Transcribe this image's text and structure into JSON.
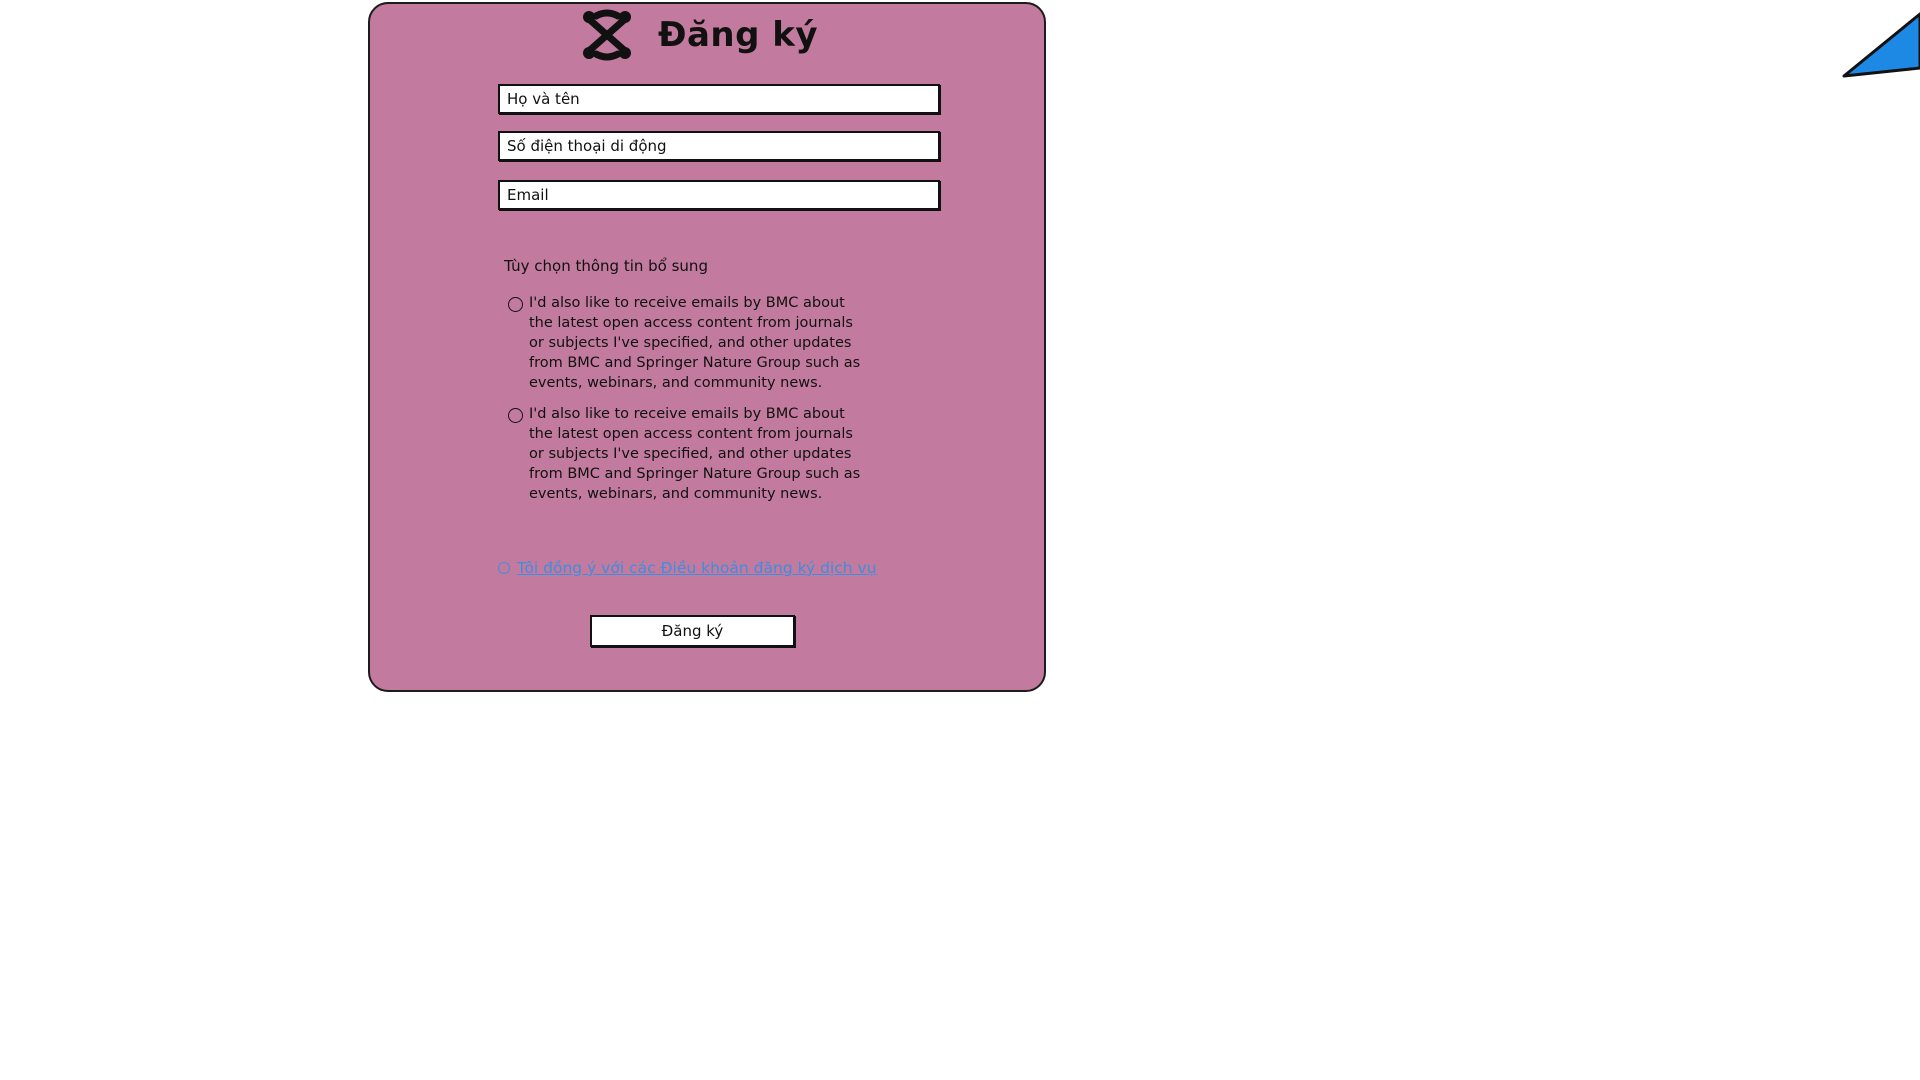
{
  "form": {
    "title": "Đăng ký",
    "logo_icon": "joomla-logo-icon",
    "fields": {
      "name_placeholder": "Họ và tên",
      "phone_placeholder": "Số điện thoại di động",
      "email_placeholder": "Email"
    },
    "optional_section_label": "Tùy chọn thông tin bổ sung",
    "options": [
      {
        "text": "I'd also like to receive emails by BMC about\nthe latest open access content from journals\nor subjects I've specified, and other updates\nfrom BMC and Springer Nature Group such as\nevents, webinars, and community news.",
        "selected": false
      },
      {
        "text": "I'd also like to receive emails by BMC about\nthe latest open access content from journals\nor subjects I've specified, and other updates\nfrom BMC and Springer Nature Group such as\nevents, webinars, and community news.",
        "selected": false
      }
    ],
    "terms_link": "Tôi đồng ý với các Điều khoản đăng ký dịch vụ",
    "submit_label": "Đăng ký"
  },
  "colors": {
    "panel_background": "#c27b9e",
    "link": "#3d8de0",
    "arrow": "#1e88e5"
  },
  "decorations": {
    "corner_icon": "blue-arrow-icon"
  }
}
